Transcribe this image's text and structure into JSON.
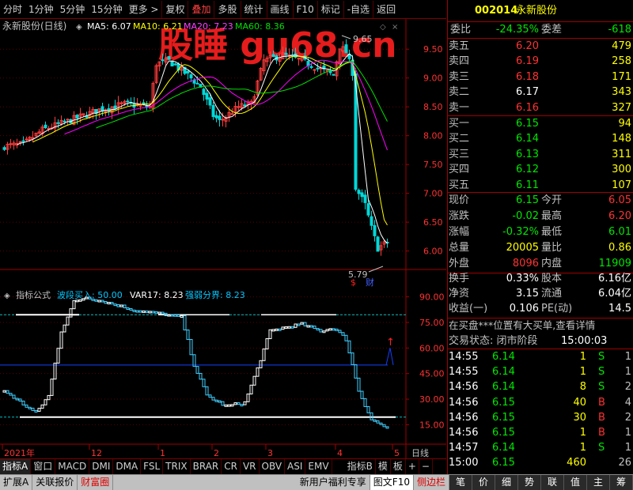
{
  "toolbar": {
    "items": [
      "分时",
      "1分钟",
      "5分钟",
      "15分钟",
      "更多 >",
      "复权",
      "叠加",
      "多股",
      "统计",
      "画线",
      "F10",
      "标记",
      "-自选",
      "返回"
    ],
    "active_index": 6
  },
  "watermark": "股睡 gu68.cn",
  "chart_header": {
    "title": "永新股份(日线)",
    "ma5": "MA5: 6.07",
    "ma10": "MA10: 6.21",
    "ma20": "MA20: 7.23",
    "ma60": "MA60: 8.36"
  },
  "price_axis": [
    "9.50",
    "9.00",
    "8.50",
    "8.00",
    "7.50",
    "7.00",
    "6.50",
    "6.00"
  ],
  "price_annotations": {
    "high": "9.65",
    "low": "5.79"
  },
  "indicator_header": {
    "label": "指标公式",
    "a": "波段买入: 50.00",
    "b": "VAR17: 8.23",
    "c": "强弱分界: 8.23"
  },
  "indicator_axis": [
    "90.00",
    "75.00",
    "60.00",
    "45.00",
    "30.00",
    "15.00"
  ],
  "date_axis": {
    "labels": [
      "2021年",
      "12",
      "1",
      "2",
      "3",
      "4",
      "5"
    ],
    "period": "日线"
  },
  "markers": {
    "s": "$",
    "cai": "财"
  },
  "chart_data": {
    "type": "candlestick",
    "title": "永新股份(日线)",
    "price_range": [
      5.79,
      9.65
    ],
    "indicator_range": [
      0,
      100
    ],
    "ma": [
      {
        "name": "MA5",
        "value": 6.07,
        "color": "#ffffff"
      },
      {
        "name": "MA10",
        "value": 6.21,
        "color": "#ffff00"
      },
      {
        "name": "MA20",
        "value": 7.23,
        "color": "#ff00ff"
      },
      {
        "name": "MA60",
        "value": 8.36,
        "color": "#00e000"
      }
    ]
  },
  "quote": {
    "code": "002014",
    "name": "永新股份",
    "weibi_label": "委比",
    "weibi": "-24.35%",
    "weicha_label": "委差",
    "weicha": "-618",
    "sell": [
      {
        "label": "卖五",
        "price": "6.20",
        "vol": "479"
      },
      {
        "label": "卖四",
        "price": "6.19",
        "vol": "258"
      },
      {
        "label": "卖三",
        "price": "6.18",
        "vol": "171"
      },
      {
        "label": "卖二",
        "price": "6.17",
        "vol": "343"
      },
      {
        "label": "卖一",
        "price": "6.16",
        "vol": "327"
      }
    ],
    "buy": [
      {
        "label": "买一",
        "price": "6.15",
        "vol": "94"
      },
      {
        "label": "买二",
        "price": "6.14",
        "vol": "148"
      },
      {
        "label": "买三",
        "price": "6.13",
        "vol": "311"
      },
      {
        "label": "买四",
        "price": "6.12",
        "vol": "300"
      },
      {
        "label": "买五",
        "price": "6.11",
        "vol": "107"
      }
    ],
    "stats": [
      {
        "l1": "现价",
        "v1": "6.15",
        "l2": "今开",
        "v2": "6.05"
      },
      {
        "l1": "涨跌",
        "v1": "-0.02",
        "l2": "最高",
        "v2": "6.20"
      },
      {
        "l1": "涨幅",
        "v1": "-0.32%",
        "l2": "最低",
        "v2": "6.01"
      },
      {
        "l1": "总量",
        "v1": "20005",
        "l2": "量比",
        "v2": "0.86"
      },
      {
        "l1": "外盘",
        "v1": "8096",
        "l2": "内盘",
        "v2": "11909"
      }
    ],
    "fund": [
      {
        "l1": "换手",
        "v1": "0.33%",
        "l2": "股本",
        "v2": "6.16亿"
      },
      {
        "l1": "净资",
        "v1": "3.15",
        "l2": "流通",
        "v2": "6.04亿"
      },
      {
        "l1": "收益(一)",
        "v1": "0.106",
        "l2": "PE(动)",
        "v2": "14.5"
      }
    ],
    "notice": "在买盘***位置有大买单,查看详情",
    "status_label": "交易状态: 闭市阶段",
    "status_time": "15:00:03",
    "ticks": [
      {
        "t": "14:55",
        "p": "6.14",
        "v": "1",
        "d": "S",
        "n": "1"
      },
      {
        "t": "14:55",
        "p": "6.14",
        "v": "1",
        "d": "S",
        "n": "1"
      },
      {
        "t": "14:56",
        "p": "6.14",
        "v": "8",
        "d": "S",
        "n": "2"
      },
      {
        "t": "14:56",
        "p": "6.15",
        "v": "40",
        "d": "B",
        "n": "4"
      },
      {
        "t": "14:56",
        "p": "6.15",
        "v": "30",
        "d": "B",
        "n": "2"
      },
      {
        "t": "14:56",
        "p": "6.15",
        "v": "1",
        "d": "B",
        "n": "1"
      },
      {
        "t": "14:57",
        "p": "6.14",
        "v": "1",
        "d": "S",
        "n": "1"
      },
      {
        "t": "15:00",
        "p": "6.15",
        "v": "460",
        "d": "",
        "n": "26"
      }
    ]
  },
  "tabs": {
    "items": [
      "指标A",
      "窗口",
      "MACD",
      "DMI",
      "DMA",
      "FSL",
      "TRIX",
      "BRAR",
      "CR",
      "VR",
      "OBV",
      "ASI",
      "EMV",
      "指标B",
      "模",
      "板",
      "+",
      "−"
    ],
    "active_index": 0
  },
  "statusbar": {
    "left": [
      "扩展A",
      "关联报价",
      "财富圈"
    ],
    "middle": [
      "新用户福利专享",
      "图文F10",
      "侧边栏"
    ],
    "right": [
      "笔",
      "价",
      "细",
      "势",
      "联",
      "值",
      "主",
      "筹"
    ]
  }
}
